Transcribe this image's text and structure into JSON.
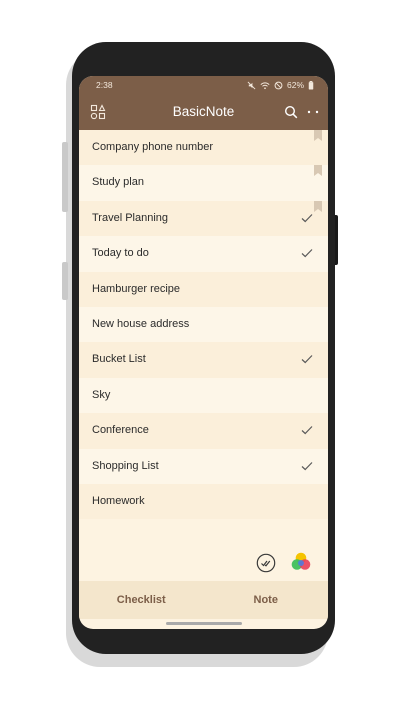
{
  "status_bar": {
    "time": "2:38",
    "battery": "62%"
  },
  "app_bar": {
    "title": "BasicNote",
    "icons": [
      "categories-icon",
      "search-icon",
      "more-icon"
    ]
  },
  "notes": [
    {
      "title": "Company phone number",
      "checked": false,
      "bookmarked": true
    },
    {
      "title": "Study plan",
      "checked": false,
      "bookmarked": true
    },
    {
      "title": "Travel Planning",
      "checked": true,
      "bookmarked": true
    },
    {
      "title": "Today to do",
      "checked": true,
      "bookmarked": false
    },
    {
      "title": "Hamburger recipe",
      "checked": false,
      "bookmarked": false
    },
    {
      "title": "New house address",
      "checked": false,
      "bookmarked": false
    },
    {
      "title": "Bucket List",
      "checked": true,
      "bookmarked": false
    },
    {
      "title": "Sky",
      "checked": false,
      "bookmarked": false
    },
    {
      "title": "Conference",
      "checked": true,
      "bookmarked": false
    },
    {
      "title": "Shopping List",
      "checked": true,
      "bookmarked": false
    },
    {
      "title": "Homework",
      "checked": false,
      "bookmarked": false
    }
  ],
  "bottom_tabs": {
    "checklist": "Checklist",
    "note": "Note"
  },
  "colors": {
    "app_bar": "#7c5e48",
    "list_background": "#fdf3e1",
    "accent_text": "#7c5e48",
    "bookmark": "#d8c8b3"
  }
}
